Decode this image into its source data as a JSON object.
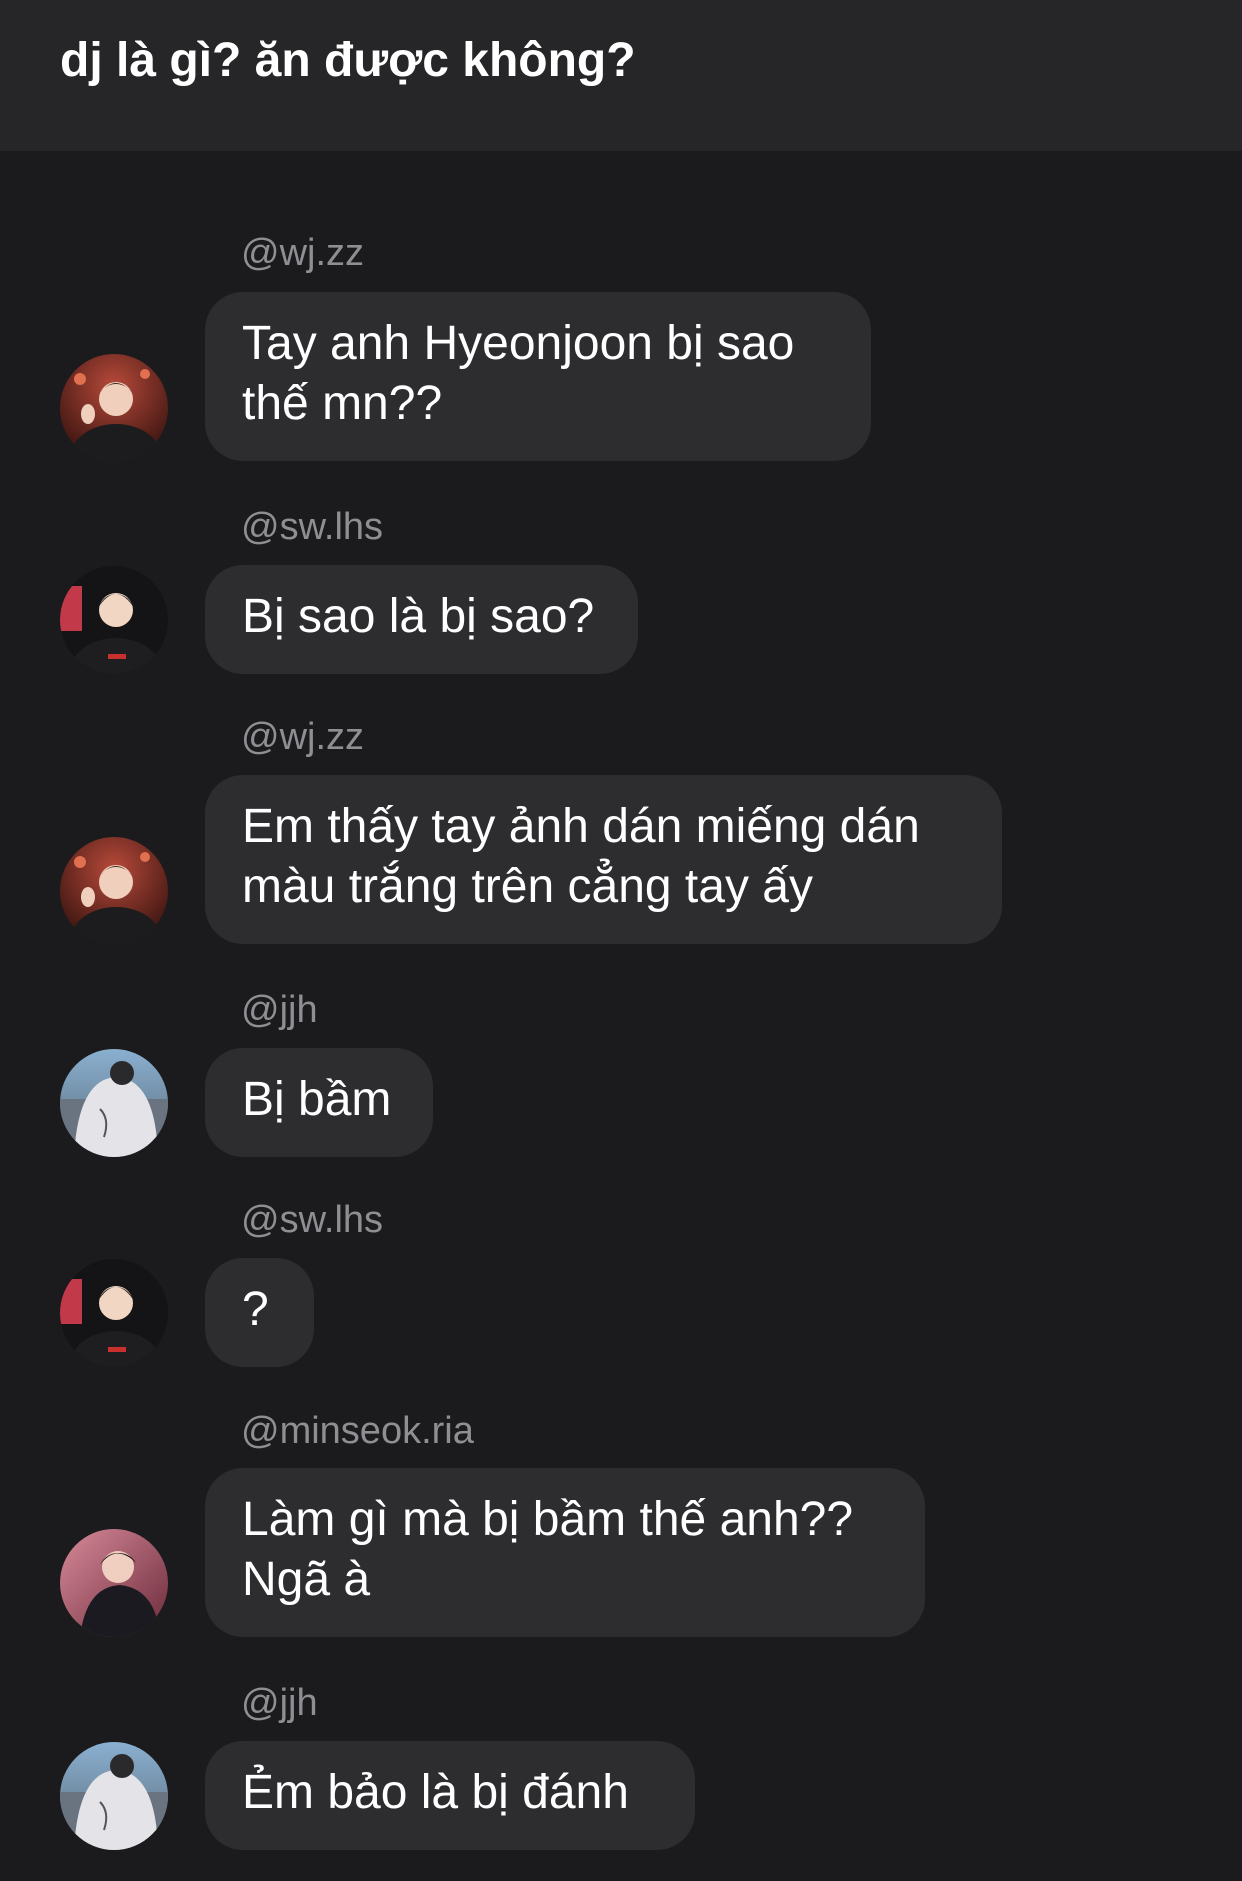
{
  "header": {
    "title": "dj là gì? ăn được không?"
  },
  "messages": [
    {
      "sender": "@wj.zz",
      "text": "Tay anh Hyeonjoon bị sao\nthế mn??",
      "avatar": "avatar-wjzz"
    },
    {
      "sender": "@sw.lhs",
      "text": "Bị sao là bị sao?",
      "avatar": "avatar-swlhs"
    },
    {
      "sender": "@wj.zz",
      "text": "Em thấy tay ảnh dán miếng dán\nmàu trắng trên cẳng tay ấy",
      "avatar": "avatar-wjzz"
    },
    {
      "sender": "@jjh",
      "text": "Bị bầm",
      "avatar": "avatar-jjh"
    },
    {
      "sender": "@sw.lhs",
      "text": "?",
      "avatar": "avatar-swlhs"
    },
    {
      "sender": "@minseok.ria",
      "text": "Làm gì mà bị bầm thế anh??\nNgã à",
      "avatar": "avatar-minseok"
    },
    {
      "sender": "@jjh",
      "text": "Ẻm bảo là bị đánh",
      "avatar": "avatar-jjh"
    }
  ],
  "colors": {
    "background": "#1b1b1d",
    "header": "#262628",
    "bubble": "#2d2d30",
    "sender": "#8e8e93",
    "text": "#ffffff"
  }
}
